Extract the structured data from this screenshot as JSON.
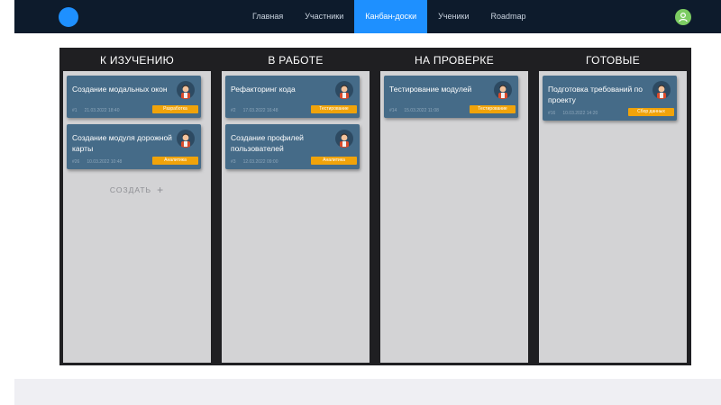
{
  "nav": {
    "items": [
      {
        "label": "Главная"
      },
      {
        "label": "Участники"
      },
      {
        "label": "Канбан-доски"
      },
      {
        "label": "Ученики"
      },
      {
        "label": "Roadmap"
      }
    ],
    "active_index": 2
  },
  "colors": {
    "topbar": "#0d1b2c",
    "accent": "#1e90ff",
    "card": "#456b88",
    "tag": "#f0a30a",
    "column_bg": "#d3d3d5",
    "board_bg": "#1f1f22"
  },
  "board": {
    "columns": [
      {
        "title": "К ИЗУЧЕНИЮ",
        "cards": [
          {
            "title": "Создание модальных окон",
            "id": "#1",
            "date": "21.03.2022 18:40",
            "tag": "Разработка"
          },
          {
            "title": "Создание модуля дорожной карты",
            "id": "#26",
            "date": "10.03.2022 10:48",
            "tag": "Аналитика"
          }
        ],
        "create_label": "СОЗДАТЬ"
      },
      {
        "title": "В РАБОТЕ",
        "cards": [
          {
            "title": "Рефакторинг кода",
            "id": "#2",
            "date": "17.03.2022 16:48",
            "tag": "Тестирование"
          },
          {
            "title": "Создание профилей пользователей",
            "id": "#3",
            "date": "12.03.2022 09:00",
            "tag": "Аналитика"
          }
        ]
      },
      {
        "title": "НА ПРОВЕРКЕ",
        "cards": [
          {
            "title": "Тестирование модулей",
            "id": "#14",
            "date": "15.03.2022 11:08",
            "tag": "Тестирование"
          }
        ]
      },
      {
        "title": "ГОТОВЫЕ",
        "cards": [
          {
            "title": "Подготовка требований по проекту",
            "id": "#16",
            "date": "10.03.2022 14:20",
            "tag": "Сбор данных"
          }
        ]
      }
    ]
  }
}
